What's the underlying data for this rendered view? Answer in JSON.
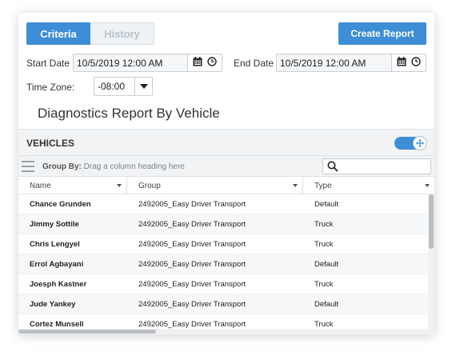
{
  "tabs": {
    "criteria": "Criteria",
    "history": "History"
  },
  "actions": {
    "create_report": "Create Report"
  },
  "start_date": {
    "label": "Start Date",
    "value": "10/5/2019 12:00 AM"
  },
  "end_date": {
    "label": "End Date",
    "value": "10/5/2019 12:00 AM"
  },
  "time_zone": {
    "label": "Time Zone:",
    "value": "-08:00"
  },
  "report_title": "Diagnostics Report By Vehicle",
  "vehicles": {
    "title": "VEHICLES",
    "group_by_label": "Group By:",
    "group_by_hint": "Drag a column heading here",
    "columns": {
      "name": "Name",
      "group": "Group",
      "type": "Type"
    },
    "rows": [
      {
        "name": "Chance Grunden",
        "group": "2492005_Easy Driver Transport",
        "type": "Default"
      },
      {
        "name": "Jimmy Sottile",
        "group": "2492005_Easy Driver Transport",
        "type": "Truck"
      },
      {
        "name": "Chris Lengyel",
        "group": "2492005_Easy Driver Transport",
        "type": "Truck"
      },
      {
        "name": "Errol Agbayani",
        "group": "2492005_Easy Driver Transport",
        "type": "Default"
      },
      {
        "name": "Joesph Kastner",
        "group": "2492005_Easy Driver Transport",
        "type": "Truck"
      },
      {
        "name": "Jude Yankey",
        "group": "2492005_Easy Driver Transport",
        "type": "Default"
      },
      {
        "name": "Cortez Munsell",
        "group": "2492005_Easy Driver Transport",
        "type": "Truck"
      }
    ]
  },
  "icons": {
    "calendar": "calendar-icon",
    "clock": "clock-icon",
    "search": "search-icon",
    "menu": "hamburger-icon",
    "dropdown": "chevron-down-icon",
    "expand": "expand-arrows-icon"
  },
  "colors": {
    "accent": "#3d8ed6",
    "header_bg": "#f1f3f5"
  }
}
